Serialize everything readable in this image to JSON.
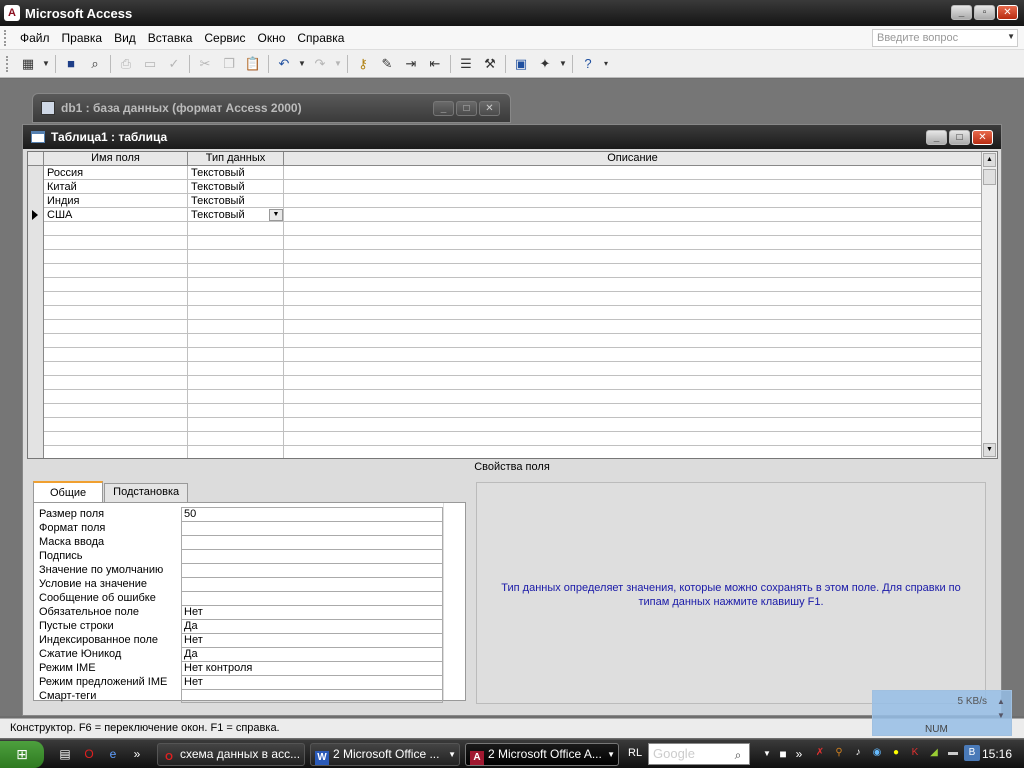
{
  "app": {
    "title": "Microsoft Access",
    "logo": "A"
  },
  "menu": {
    "items": [
      "Файл",
      "Правка",
      "Вид",
      "Вставка",
      "Сервис",
      "Окно",
      "Справка"
    ],
    "ask_placeholder": "Введите вопрос"
  },
  "toolbar": {
    "icons": [
      "view-icon",
      "save-icon",
      "search-icon",
      "print-icon",
      "print-preview-icon",
      "spelling-icon",
      "cut-icon",
      "copy-icon",
      "paste-icon",
      "undo-icon",
      "redo-icon",
      "primary-key-icon",
      "build-icon",
      "insert-rows-icon",
      "delete-rows-icon",
      "properties-icon",
      "builder-icon",
      "database-window-icon",
      "new-object-icon",
      "help-icon"
    ]
  },
  "db_window": {
    "title": "db1 : база данных (формат Access 2000)"
  },
  "table_window": {
    "title": "Таблица1 : таблица",
    "columns": [
      "Имя поля",
      "Тип данных",
      "Описание"
    ],
    "rows": [
      {
        "name": "Россия",
        "type": "Текстовый",
        "desc": ""
      },
      {
        "name": "Китай",
        "type": "Текстовый",
        "desc": ""
      },
      {
        "name": "Индия",
        "type": "Текстовый",
        "desc": ""
      },
      {
        "name": "США",
        "type": "Текстовый",
        "desc": ""
      }
    ],
    "current_row": 3
  },
  "field_properties": {
    "title": "Свойства поля",
    "tabs": [
      "Общие",
      "Подстановка"
    ],
    "active_tab": 0,
    "rows": [
      {
        "label": "Размер поля",
        "value": "50"
      },
      {
        "label": "Формат поля",
        "value": ""
      },
      {
        "label": "Маска ввода",
        "value": ""
      },
      {
        "label": "Подпись",
        "value": ""
      },
      {
        "label": "Значение по умолчанию",
        "value": ""
      },
      {
        "label": "Условие на значение",
        "value": ""
      },
      {
        "label": "Сообщение об ошибке",
        "value": ""
      },
      {
        "label": "Обязательное поле",
        "value": "Нет"
      },
      {
        "label": "Пустые строки",
        "value": "Да"
      },
      {
        "label": "Индексированное поле",
        "value": "Нет"
      },
      {
        "label": "Сжатие Юникод",
        "value": "Да"
      },
      {
        "label": "Режим IME",
        "value": "Нет контроля"
      },
      {
        "label": "Режим предложений IME",
        "value": "Нет"
      },
      {
        "label": "Смарт-теги",
        "value": ""
      }
    ],
    "help_text": "Тип данных определяет значения, которые можно сохранять в этом поле.  Для справки по типам данных нажмите клавишу F1."
  },
  "statusbar": {
    "text": "Конструктор.  F6 = переключение окон.  F1 = справка.",
    "num": "NUM",
    "rate": "5 KB/s"
  },
  "taskbar": {
    "tasks": [
      {
        "label": "схема данных в асс...",
        "icon": "opera-icon",
        "glyph": "O"
      },
      {
        "label": "2 Microsoft Office ...",
        "icon": "word-icon",
        "glyph": "W"
      },
      {
        "label": "2 Microsoft Office A...",
        "icon": "access-icon",
        "glyph": "A"
      }
    ],
    "lang": "RL",
    "search_placeholder": "Google",
    "clock": "15:16"
  }
}
